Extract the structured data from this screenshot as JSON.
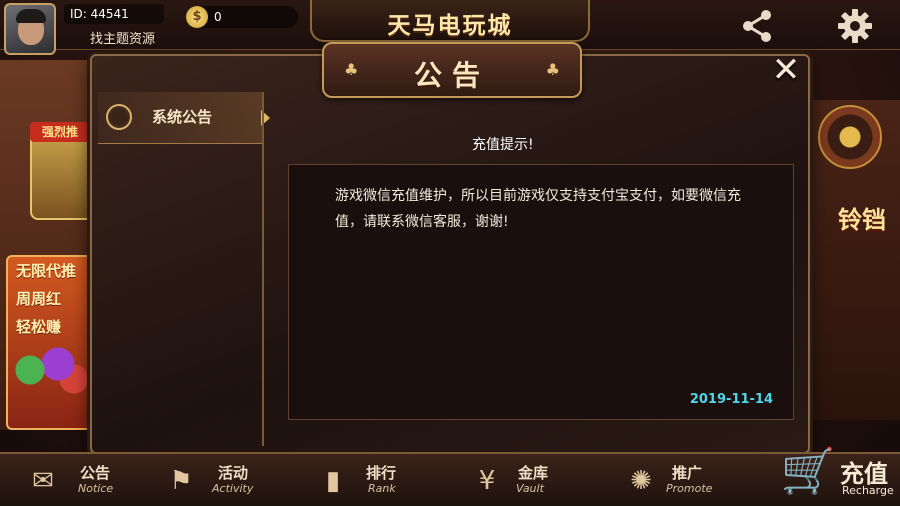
{
  "header": {
    "user_id": "ID: 44541",
    "user_tag": "找主题资源",
    "coins": "0",
    "game_title": "天马电玩城"
  },
  "background": {
    "slot_tag": "强烈推",
    "promo_lines": [
      "无限代推",
      "周周红",
      "轻松赚"
    ],
    "right_text": "铃铛"
  },
  "modal": {
    "title": "公告",
    "close_symbol": "✕",
    "sidebar": [
      {
        "label": "系统公告",
        "selected": true
      }
    ],
    "notice": {
      "title": "充值提示!",
      "body": "游戏微信充值维护，所以目前游戏仅支持支付宝支付，如要微信充值，请联系微信客服，谢谢!",
      "date": "2019-11-14"
    }
  },
  "nav": [
    {
      "cn": "公告",
      "en": "Notice",
      "icon": "envelope-icon"
    },
    {
      "cn": "活动",
      "en": "Activity",
      "icon": "flag-icon"
    },
    {
      "cn": "排行",
      "en": "Rank",
      "icon": "bars-icon"
    },
    {
      "cn": "金库",
      "en": "Vault",
      "icon": "yen-icon"
    },
    {
      "cn": "推广",
      "en": "Promote",
      "icon": "promote-icon"
    }
  ],
  "recharge": {
    "cn": "充值",
    "en": "Recharge"
  },
  "colors": {
    "accent": "#c59a58",
    "date": "#4ed7ea",
    "background": "#1a0f0c"
  }
}
